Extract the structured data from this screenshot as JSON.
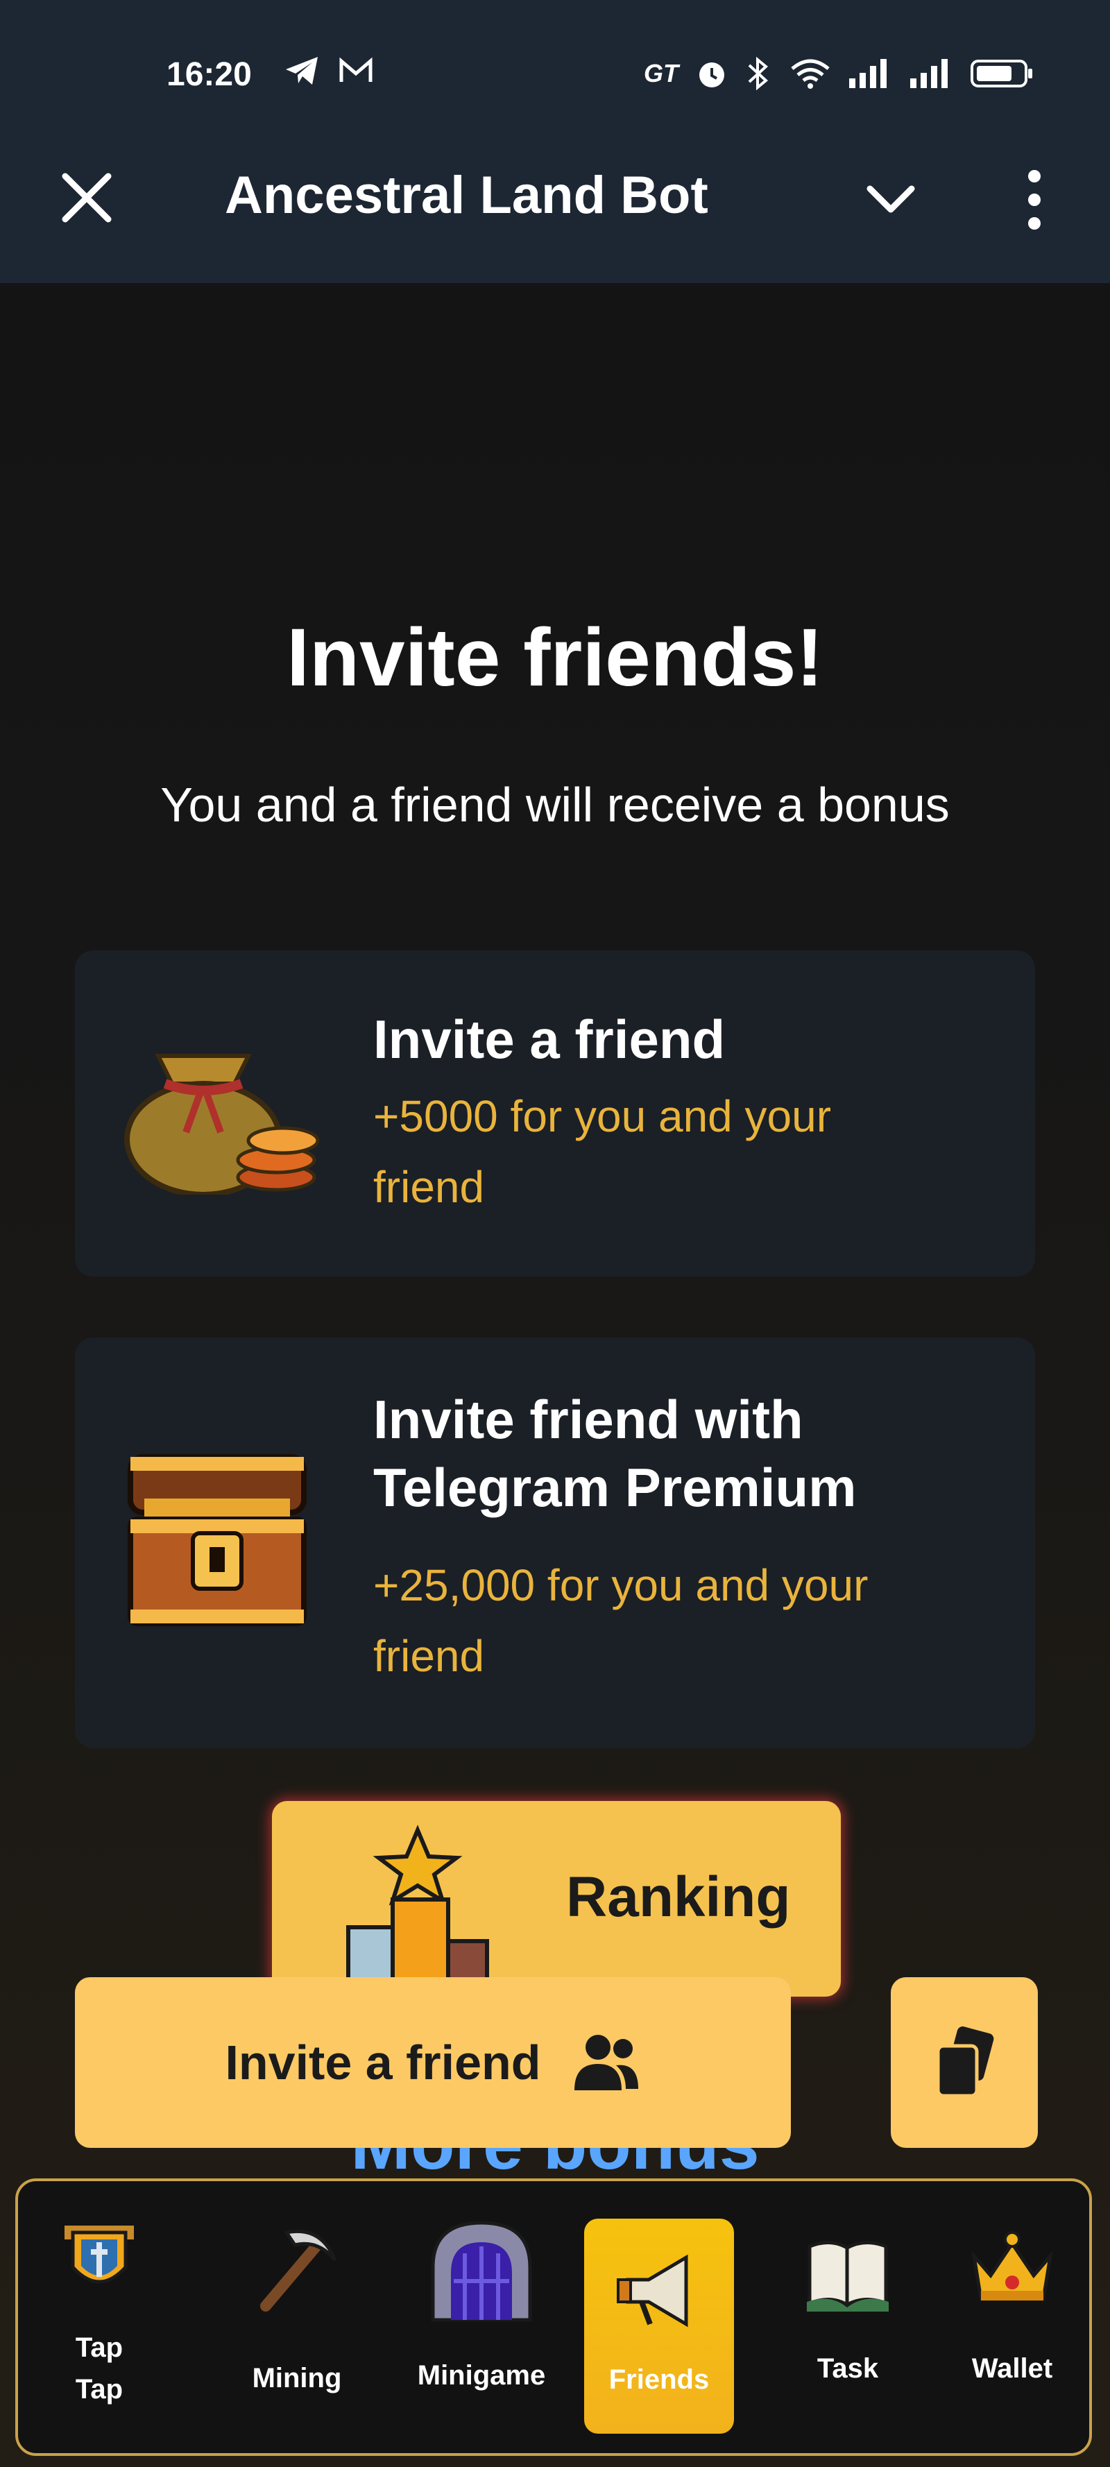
{
  "status_bar": {
    "time": "16:20"
  },
  "header": {
    "title": "Ancestral Land Bot"
  },
  "main": {
    "title": "Invite friends!",
    "subtitle": "You and a friend will receive a bonus",
    "cards": [
      {
        "title": "Invite a friend",
        "reward": "+5000 for you and your friend",
        "icon": "coin-bag-icon"
      },
      {
        "title": "Invite friend with Telegram Premium",
        "reward": "+25,000 for you and your friend",
        "icon": "treasure-chest-icon"
      }
    ],
    "ranking_label": "Ranking",
    "more_bonus_label": "More bonus",
    "invite_button_label": "Invite a friend"
  },
  "bottom_nav": {
    "items": [
      {
        "label": "Tap Tap",
        "icon": "shield-sword-icon"
      },
      {
        "label": "Mining",
        "icon": "pickaxe-icon"
      },
      {
        "label": "Minigame",
        "icon": "dungeon-gate-icon"
      },
      {
        "label": "Friends",
        "icon": "megaphone-icon",
        "active": true
      },
      {
        "label": "Task",
        "icon": "book-icon"
      },
      {
        "label": "Wallet",
        "icon": "crown-icon"
      }
    ]
  },
  "colors": {
    "accent_yellow": "#fcc965",
    "reward_text": "#e9b43c",
    "more_bonus_blue": "#5aa6ff",
    "header_bg": "#1d2733"
  }
}
